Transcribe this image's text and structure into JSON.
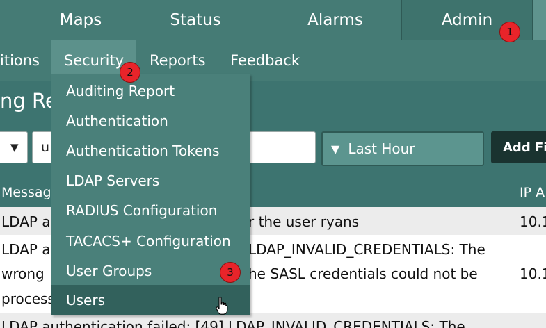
{
  "top_nav": {
    "tabs": [
      {
        "label": "Maps"
      },
      {
        "label": "Status"
      },
      {
        "label": "Alarms"
      },
      {
        "label": "Admin"
      }
    ]
  },
  "sub_nav": {
    "items": [
      {
        "label": "itions"
      },
      {
        "label": "Security"
      },
      {
        "label": "Reports"
      },
      {
        "label": "Feedback"
      }
    ]
  },
  "page": {
    "title": "ng Rep"
  },
  "filters": {
    "left_select_arrow": "▼",
    "text_value": "u",
    "range_value": "Last Hour",
    "range_arrow": "▼",
    "add_filter_label": "Add Fil"
  },
  "table": {
    "headers": [
      "Messag",
      "IP A"
    ],
    "rows": [
      {
        "lines": [
          "LDAP a",
          "r the user ryans"
        ],
        "ip": "10.1"
      },
      {
        "lines": [
          "LDAP a",
          "LDAP_INVALID_CREDENTIALS: The",
          "wrong",
          "he SASL credentials could not be",
          "process"
        ],
        "ip": "10.1"
      },
      {
        "lines": [
          "LDAP authentication failed: [49] LDAP_INVALID_CREDENTIALS: The"
        ]
      }
    ]
  },
  "security_menu": {
    "items": [
      {
        "label": "Auditing Report"
      },
      {
        "label": "Authentication"
      },
      {
        "label": "Authentication Tokens"
      },
      {
        "label": "LDAP Servers"
      },
      {
        "label": "RADIUS Configuration"
      },
      {
        "label": "TACACS+ Configuration"
      },
      {
        "label": "User Groups"
      },
      {
        "label": "Users"
      }
    ]
  },
  "annotations": {
    "badges": [
      "1",
      "2",
      "3"
    ]
  },
  "colors": {
    "nav_bg": "#457b75",
    "menu_bg": "#4a807a",
    "menu_hover": "#32615c",
    "badge_red": "#e8242a"
  },
  "icons": {
    "cursor": "pointer-hand-icon",
    "dropdown": "triangle-down-icon"
  }
}
